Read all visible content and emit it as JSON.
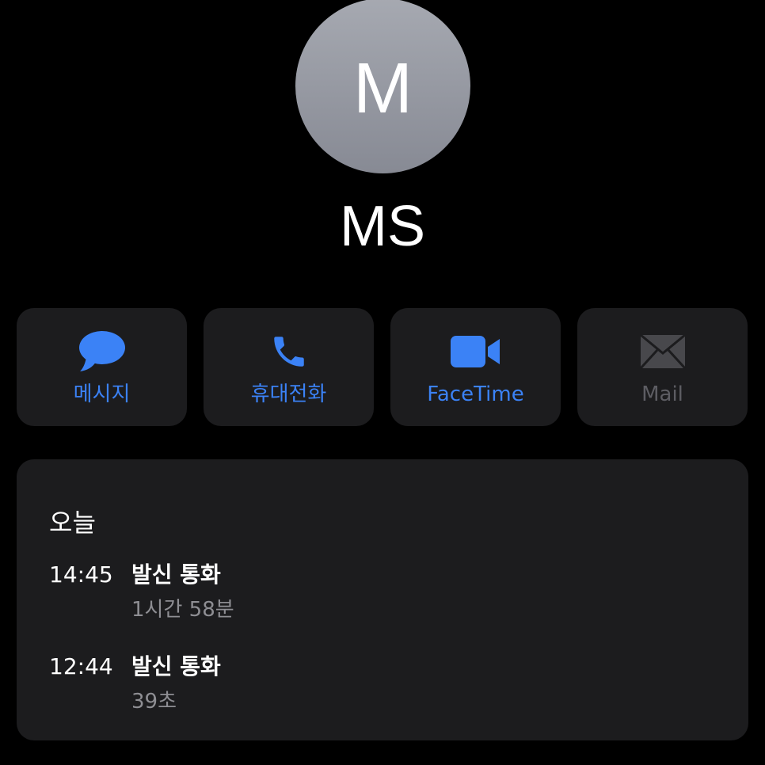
{
  "contact": {
    "initial": "M",
    "name": "MS",
    "avatar_gradient": [
      "#a6a9b1",
      "#878a94"
    ]
  },
  "actions": [
    {
      "label": "메시지",
      "icon": "message-bubble-icon",
      "enabled": true
    },
    {
      "label": "휴대전화",
      "icon": "phone-icon",
      "enabled": true
    },
    {
      "label": "FaceTime",
      "icon": "video-camera-icon",
      "enabled": true
    },
    {
      "label": "Mail",
      "icon": "mail-envelope-icon",
      "enabled": false
    }
  ],
  "recent_calls": {
    "section_title": "오늘",
    "calls": [
      {
        "time": "14:45",
        "type": "발신 통화",
        "duration": "1시간 58분"
      },
      {
        "time": "12:44",
        "type": "발신 통화",
        "duration": "39초"
      }
    ]
  },
  "colors": {
    "background": "#000000",
    "card": "#1c1c1e",
    "accent": "#3b82f6",
    "disabled": "#5d5d63",
    "secondary_text": "#8e8e93"
  }
}
